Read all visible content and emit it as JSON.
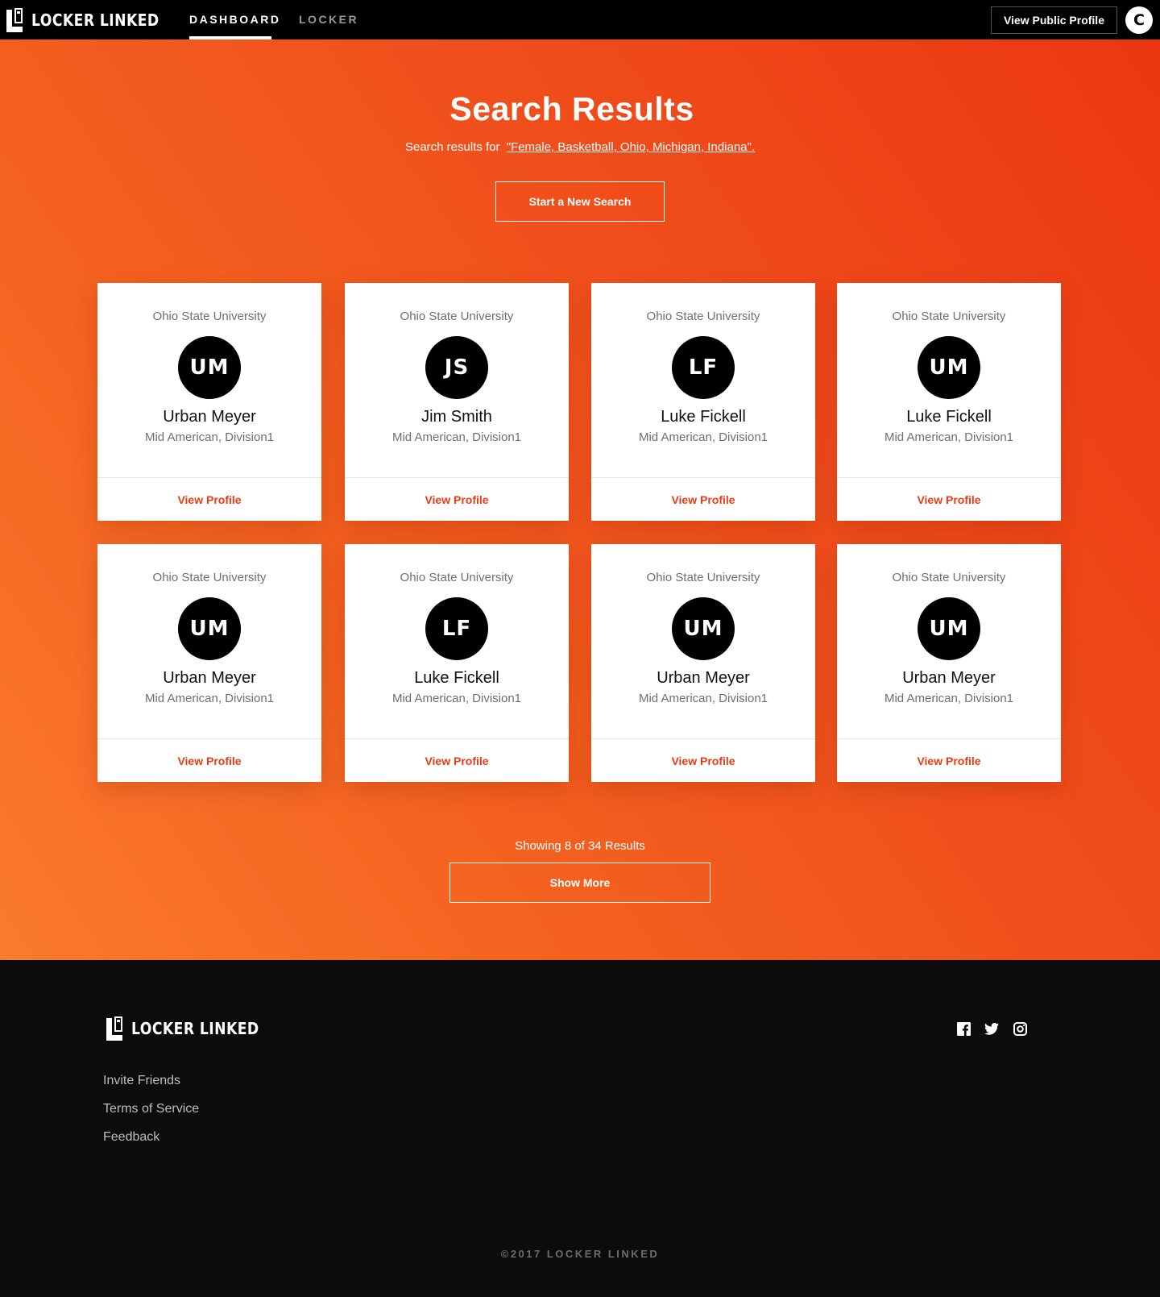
{
  "nav": {
    "brand": "LOCKER LINKED",
    "tabs": [
      {
        "label": "DASHBOARD",
        "active": true
      },
      {
        "label": "LOCKER",
        "active": false
      }
    ],
    "public_profile_label": "View Public Profile",
    "avatar_initial": "C"
  },
  "hero": {
    "title": "Search Results",
    "subtitle_prefix": "Search results for",
    "query": "\"Female, Basketball, Ohio, Michigan, Indiana\".",
    "new_search_label": "Start a New Search"
  },
  "results": [
    {
      "school": "Ohio State University",
      "initials": "UM",
      "name": "Urban Meyer",
      "conference": "Mid American, Division1",
      "link": "View Profile"
    },
    {
      "school": "Ohio State University",
      "initials": "JS",
      "name": "Jim Smith",
      "conference": "Mid American, Division1",
      "link": "View Profile"
    },
    {
      "school": "Ohio State University",
      "initials": "LF",
      "name": "Luke Fickell",
      "conference": "Mid American, Division1",
      "link": "View Profile"
    },
    {
      "school": "Ohio State University",
      "initials": "UM",
      "name": "Luke Fickell",
      "conference": "Mid American, Division1",
      "link": "View Profile"
    },
    {
      "school": "Ohio State University",
      "initials": "UM",
      "name": "Urban Meyer",
      "conference": "Mid American, Division1",
      "link": "View Profile"
    },
    {
      "school": "Ohio State University",
      "initials": "LF",
      "name": "Luke Fickell",
      "conference": "Mid American, Division1",
      "link": "View Profile"
    },
    {
      "school": "Ohio State University",
      "initials": "UM",
      "name": "Urban Meyer",
      "conference": "Mid American, Division1",
      "link": "View Profile"
    },
    {
      "school": "Ohio State University",
      "initials": "UM",
      "name": "Urban Meyer",
      "conference": "Mid American, Division1",
      "link": "View Profile"
    }
  ],
  "pagination": {
    "showing_text": "Showing 8 of 34 Results",
    "show_more_label": "Show More"
  },
  "footer": {
    "brand": "LOCKER LINKED",
    "links": [
      "Invite Friends",
      "Terms of Service",
      "Feedback"
    ],
    "social_icons": [
      "facebook-icon",
      "twitter-icon",
      "instagram-icon"
    ],
    "copyright": "©2017 LOCKER LINKED"
  },
  "colors": {
    "accent": "#ea3b12",
    "gradient_start": "#ec3711",
    "gradient_end": "#fb7a2d",
    "nav_bg": "#000000",
    "footer_bg": "#0c0c0c"
  }
}
